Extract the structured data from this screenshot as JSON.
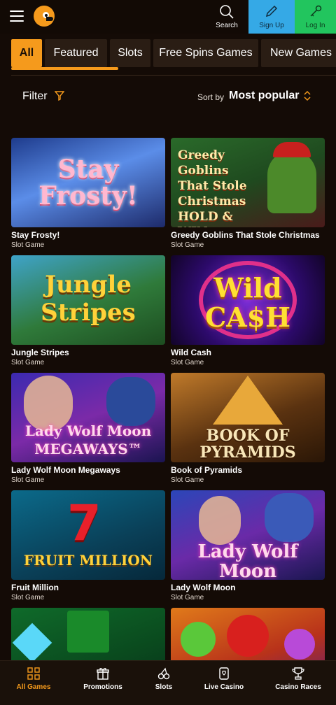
{
  "header": {
    "search_label": "Search",
    "signup_label": "Sign Up",
    "login_label": "Log In",
    "menu_icon": "hamburger-icon",
    "logo_icon": "duck-logo-icon"
  },
  "tabs": [
    {
      "label": "All",
      "active": true
    },
    {
      "label": "Featured",
      "active": false
    },
    {
      "label": "Slots",
      "active": false
    },
    {
      "label": "Free Spins Games",
      "active": false
    },
    {
      "label": "New Games",
      "active": false
    }
  ],
  "filter": {
    "label": "Filter",
    "sort_prefix": "Sort by",
    "sort_value": "Most popular"
  },
  "games": [
    {
      "title": "Stay Frosty!",
      "type": "Slot Game",
      "art": "Stay Frosty!"
    },
    {
      "title": "Greedy Goblins That Stole Christmas",
      "type": "Slot Game",
      "art": "Greedy Goblins That Stole Christmas HOLD & WIN"
    },
    {
      "title": "Jungle Stripes",
      "type": "Slot Game",
      "art": "Jungle Stripes"
    },
    {
      "title": "Wild Cash",
      "type": "Slot Game",
      "art": "Wild CA$H"
    },
    {
      "title": "Lady Wolf Moon Megaways",
      "type": "Slot Game",
      "art": "Lady Wolf Moon MEGAWAYS™"
    },
    {
      "title": "Book of Pyramids",
      "type": "Slot Game",
      "art": "BOOK OF PYRAMIDS"
    },
    {
      "title": "Fruit Million",
      "type": "Slot Game",
      "art": "FRUIT MILLION"
    },
    {
      "title": "Lady Wolf Moon",
      "type": "Slot Game",
      "art": "Lady Wolf Moon"
    },
    {
      "title": "",
      "type": "",
      "art": ""
    },
    {
      "title": "",
      "type": "",
      "art": ""
    }
  ],
  "bottom_nav": [
    {
      "label": "All Games",
      "icon": "grid-icon",
      "active": true
    },
    {
      "label": "Promotions",
      "icon": "gift-icon",
      "active": false
    },
    {
      "label": "Slots",
      "icon": "cherries-icon",
      "active": false
    },
    {
      "label": "Live Casino",
      "icon": "card-icon",
      "active": false
    },
    {
      "label": "Casino Races",
      "icon": "trophy-icon",
      "active": false
    }
  ],
  "colors": {
    "accent": "#f59a1c",
    "background": "#140b06",
    "signup": "#35a9e6",
    "login": "#22c55e"
  }
}
